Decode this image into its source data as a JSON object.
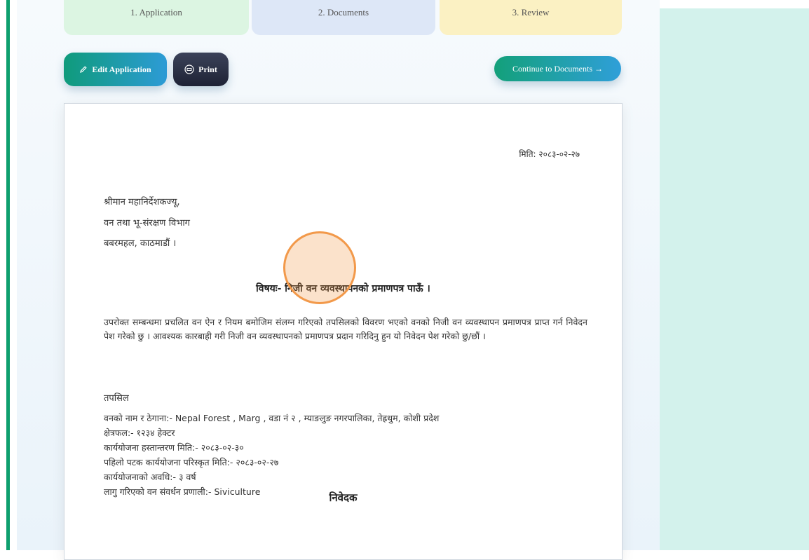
{
  "steps": [
    {
      "label": "1. Application"
    },
    {
      "label": "2. Documents"
    },
    {
      "label": "3. Review"
    }
  ],
  "toolbar": {
    "edit_label": "Edit Application",
    "print_label": "Print",
    "continue_label": "Continue to Documents →"
  },
  "letter": {
    "date": "मिति: २०८३-०२-२७",
    "addressee": [
      "श्रीमान महानिर्देशकज्यू,",
      "वन तथा भू-संरक्षण विभाग",
      "बबरमहल, काठमाडौं ।"
    ],
    "subject": "विषयः- निजी वन व्यवस्थापनको प्रमाणपत्र पाऊँ ।",
    "body": "उपरोक्त सम्बन्धमा प्रचलित वन ऐन र नियम बमोजिम संलग्न गरिएको तपसिलको विवरण भएको वनको निजी वन व्यवस्थापन प्रमाणपत्र प्राप्त गर्न निवेदन पेश गरेको छु । आवश्यक कारबाही गरी निजी वन व्यवस्थापनको प्रमाणपत्र प्रदान गरिदिनु हुन यो निवेदन पेश गरेको छु/छौं ।",
    "details_heading": "तपसिल",
    "details": [
      "वनको नाम र ठेगाना:- Nepal Forest , Marg , वडा नं २ , म्याङलुङ नगरपालिका, तेह्रथुम, कोशी प्रदेश",
      "क्षेत्रफल:- १२३४ हेक्टर",
      "कार्ययोजना हस्तान्तरण मिति:- २०८३-०२-३०",
      "पहिलो पटक कार्ययोजना परिस्कृत मिति:- २०८३-०२-२७",
      "कार्ययोजनाको अवधि:- ३ वर्ष",
      "लागु गरिएको वन संवर्धन प्रणाली:- Siviculture"
    ],
    "footer": "निवेदक"
  },
  "colors": {
    "accent": "#0e9f6e",
    "right_panel": "#d3f2ec",
    "cursor": "#f2994a"
  }
}
